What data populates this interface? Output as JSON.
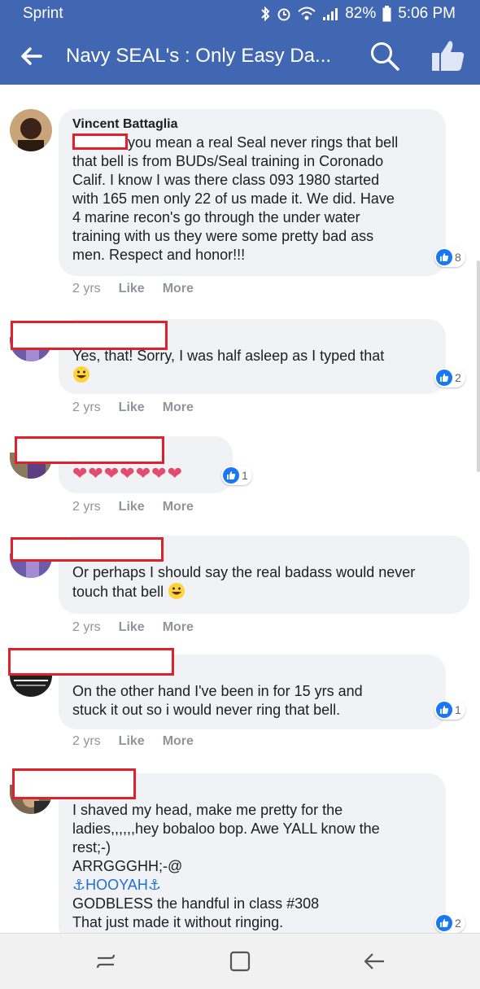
{
  "status_bar": {
    "carrier": "Sprint",
    "battery": "82%",
    "time": "5:06 PM"
  },
  "nav": {
    "title": "Navy SEAL's : Only Easy Da..."
  },
  "comments": [
    {
      "author": "Vincent Battaglia",
      "lines": [
        "you mean a real Seal never rings that bell",
        "that bell is from BUDs/Seal training in Coronado",
        "Calif. I know I was there class 093 1980 started",
        "with 165 men only 22 of us made it. We did. Have",
        "4 marine recon's go through the under water",
        "training with us they were some pretty bad ass",
        "men. Respect and honor!!!"
      ],
      "time": "2 yrs",
      "like": "Like",
      "more": "More",
      "reactions": "8"
    },
    {
      "lines": [
        "Yes, that! Sorry, I was half asleep as I typed that"
      ],
      "time": "2 yrs",
      "like": "Like",
      "more": "More",
      "reactions": "2"
    },
    {
      "lines": [
        "❤❤❤❤❤❤❤"
      ],
      "time": "2 yrs",
      "like": "Like",
      "more": "More",
      "reactions": "1"
    },
    {
      "lines": [
        "Or perhaps I should say the real badass would never",
        "touch that bell"
      ],
      "time": "2 yrs",
      "like": "Like",
      "more": "More"
    },
    {
      "lines": [
        "On the other hand I've been in for 15 yrs and",
        "stuck it out so i would never ring that bell."
      ],
      "time": "2 yrs",
      "like": "Like",
      "more": "More",
      "reactions": "1"
    },
    {
      "lines": [
        "I shaved my head, make me pretty for the",
        "ladies,,,,,,hey bobaloo bop. Awe YALL know the",
        "rest;-)",
        "ARRGGGHH;-@",
        "⚓HOOYAH⚓",
        "GODBLESS the handful in class #308",
        "That just made it without ringing."
      ],
      "reactions": "2"
    }
  ],
  "colors": {
    "header": "#4267b2",
    "bubble": "#f0f2f5",
    "like_blue": "#1877f2",
    "redaction": "#e0202a"
  }
}
